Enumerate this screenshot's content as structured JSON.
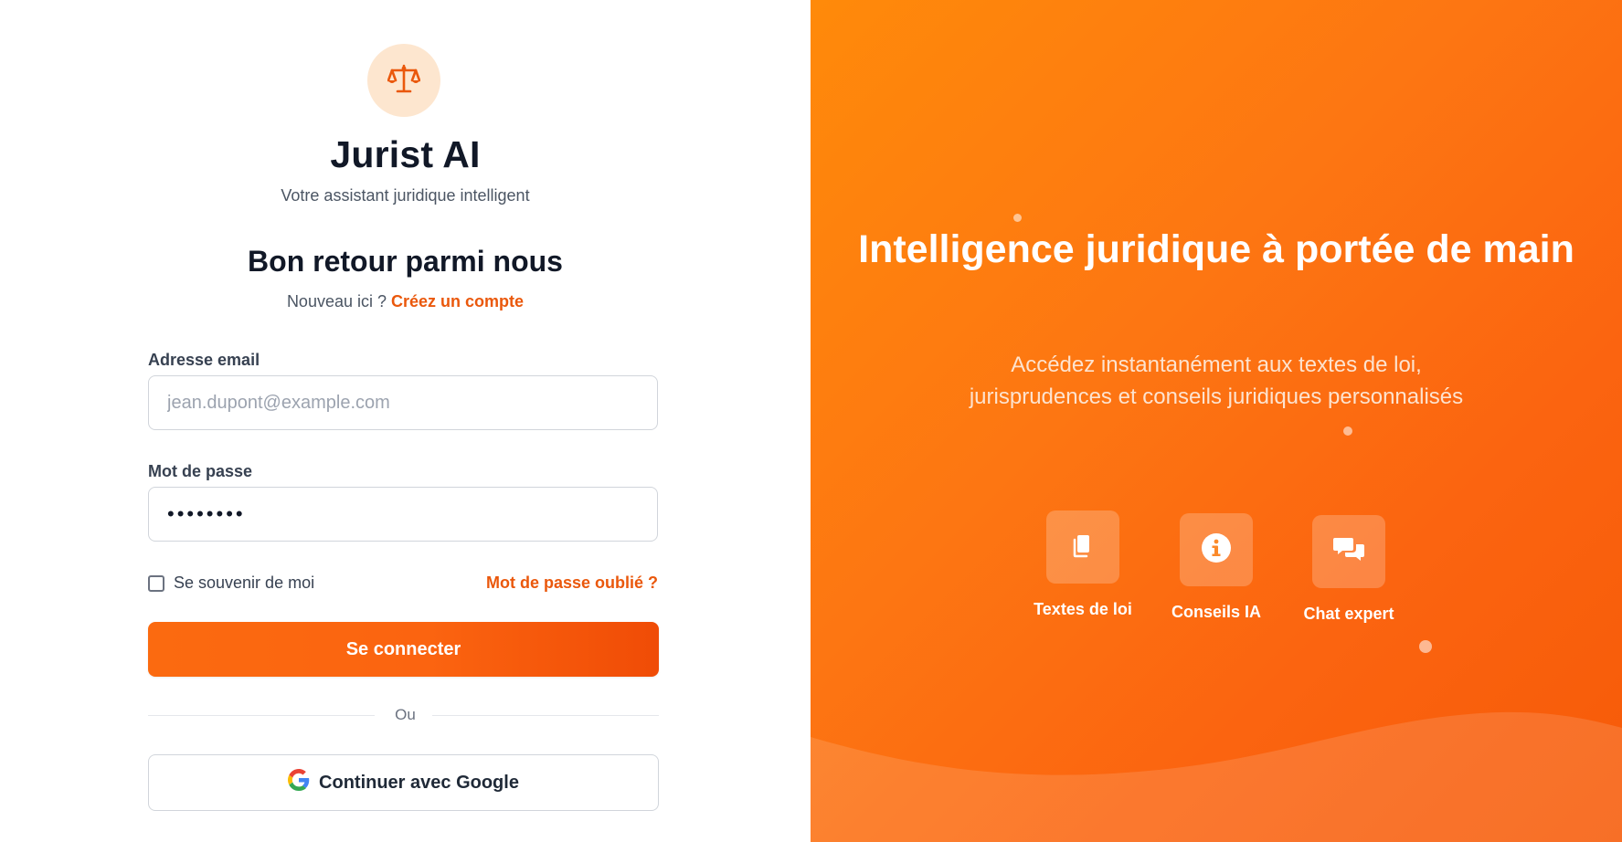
{
  "brand": {
    "name": "Jurist AI",
    "tagline": "Votre assistant juridique intelligent",
    "logo_icon": "scale-icon"
  },
  "login": {
    "heading": "Bon retour parmi nous",
    "signup_prompt": "Nouveau ici ?",
    "signup_link": "Créez un compte",
    "email_label": "Adresse email",
    "email_placeholder": "jean.dupont@example.com",
    "email_value": "",
    "password_label": "Mot de passe",
    "password_value": "••••••••",
    "remember_label": "Se souvenir de moi",
    "remember_checked": false,
    "forgot_link": "Mot de passe oublié ?",
    "submit_label": "Se connecter",
    "divider_text": "Ou",
    "google_label": "Continuer avec Google"
  },
  "hero": {
    "title": "Intelligence juridique à portée de main",
    "subtitle": "Accédez instantanément aux textes de loi, jurisprudences et conseils juridiques personnalisés",
    "features": [
      {
        "label": "Textes de loi",
        "icon": "documents-icon"
      },
      {
        "label": "Conseils IA",
        "icon": "info-icon"
      },
      {
        "label": "Chat expert",
        "icon": "chat-icon"
      }
    ]
  },
  "colors": {
    "accent": "#ea580c",
    "hero_gradient_start": "#ff8a0a",
    "hero_gradient_end": "#f65a08",
    "logo_badge": "#fde6cf"
  }
}
